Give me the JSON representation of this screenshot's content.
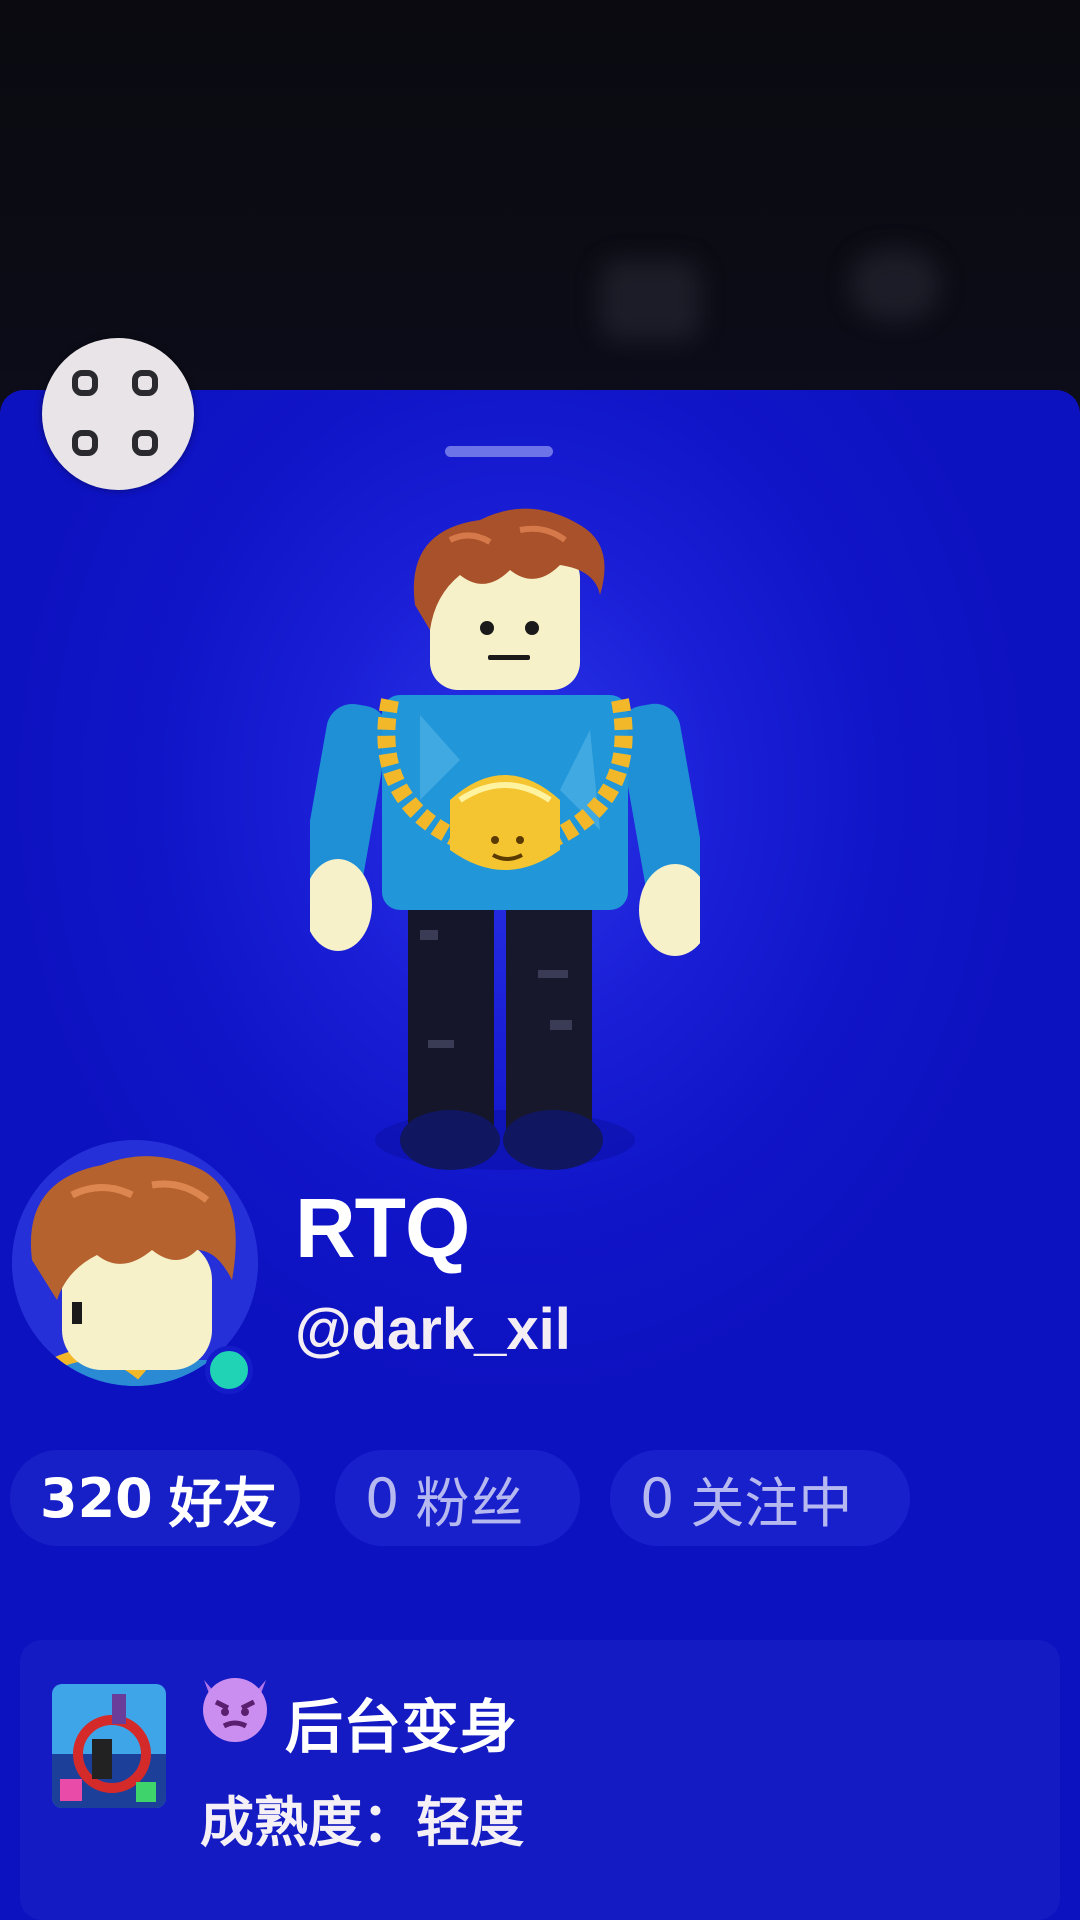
{
  "profile": {
    "display_name": "RTQ",
    "username": "@dark_xil",
    "online": true
  },
  "stats": {
    "friends_count": "320",
    "friends_label": "好友",
    "followers_count": "0",
    "followers_label": "粉丝",
    "following_count": "0",
    "following_label": "关注中"
  },
  "experience": {
    "title": "后台变身",
    "maturity": "成熟度：轻度",
    "emoji_icon": "smiling-devil-icon"
  },
  "colors": {
    "panel_blue": "#1a1fd6",
    "online_green": "#1fd3b4",
    "text_white": "#ffffff",
    "stat_muted": "#b6b8f0"
  }
}
